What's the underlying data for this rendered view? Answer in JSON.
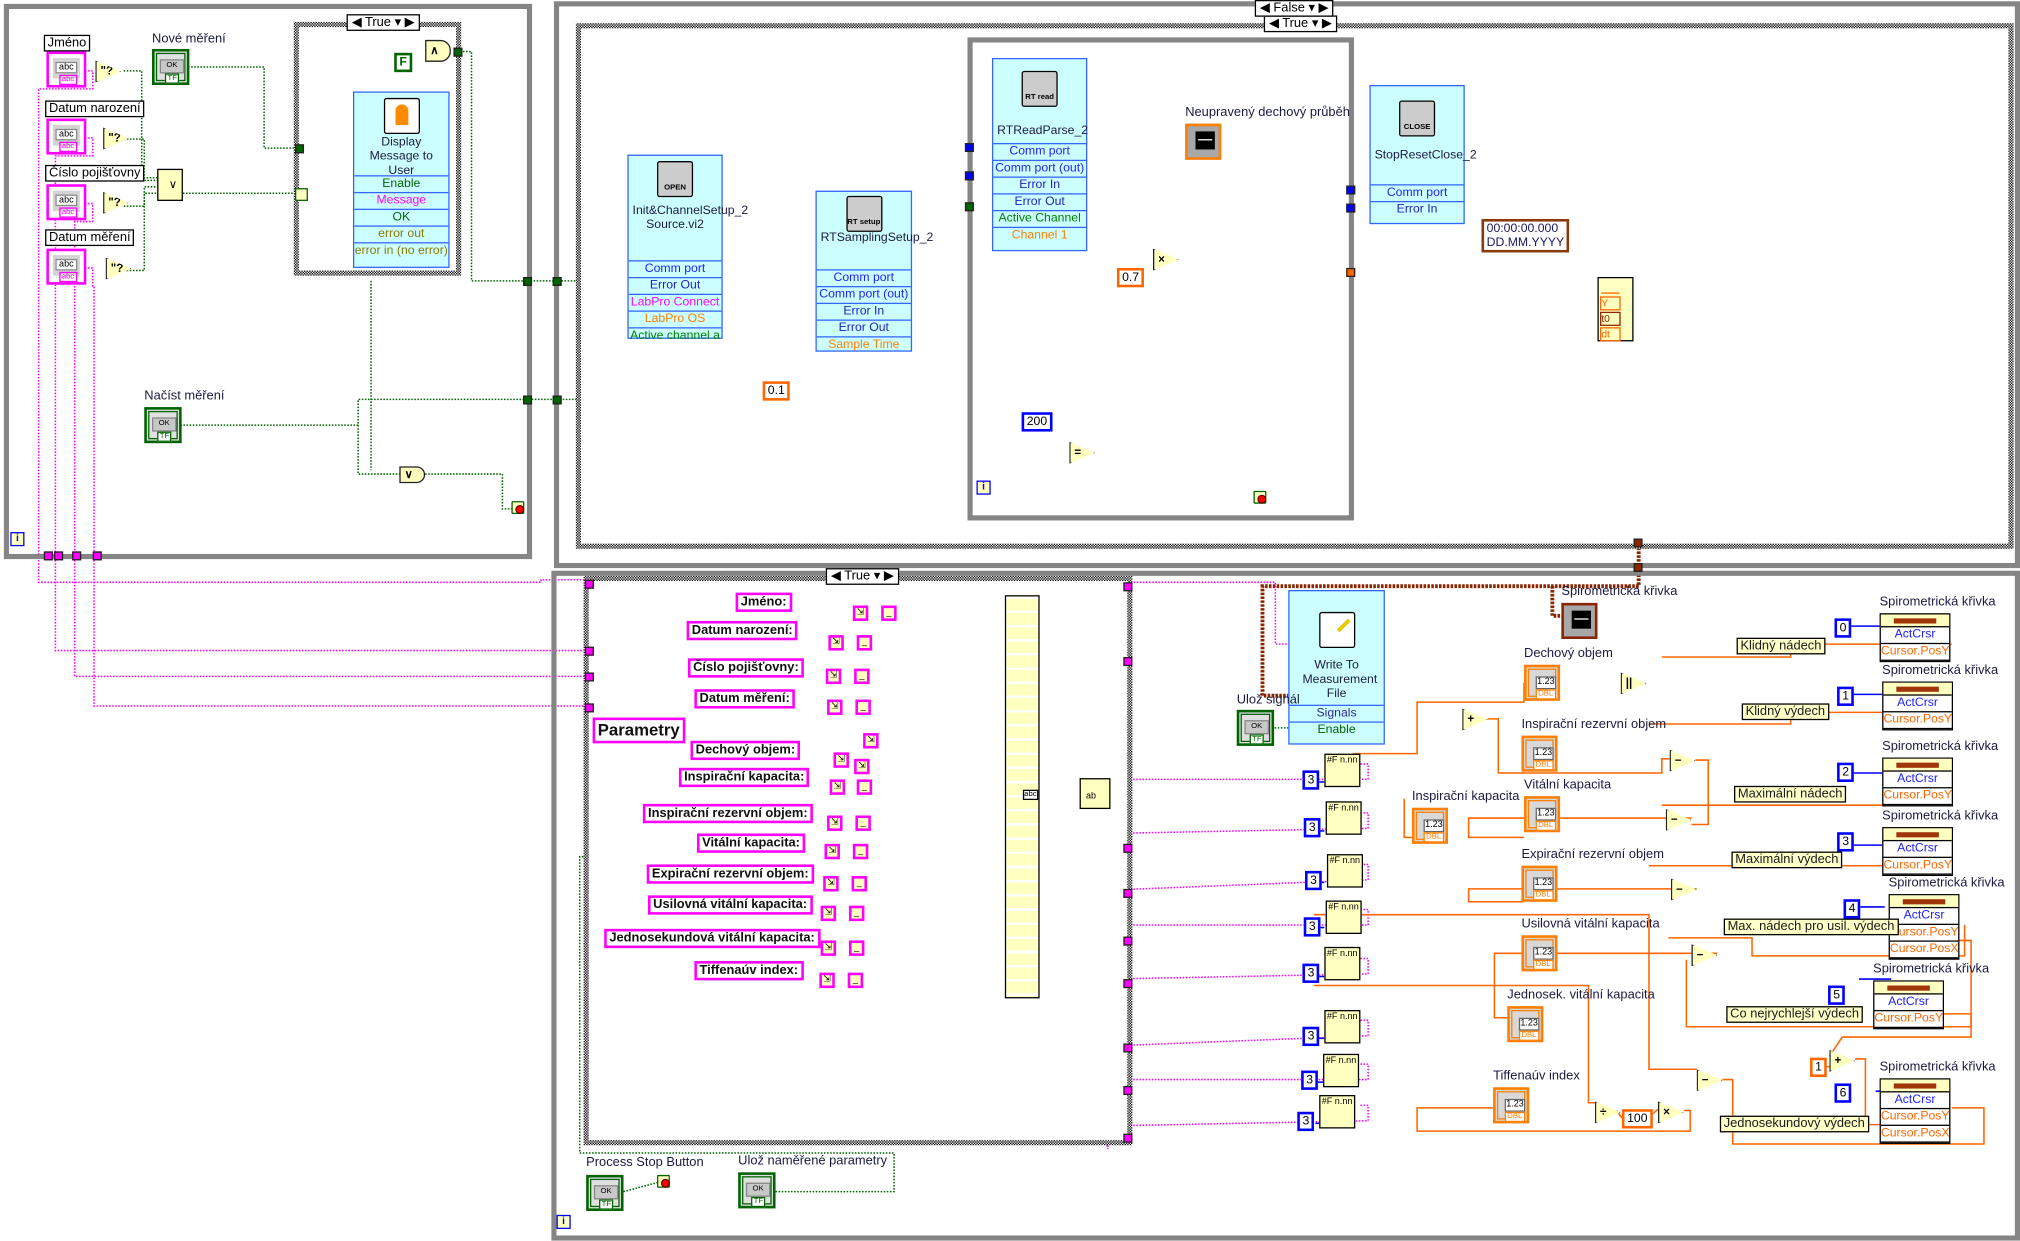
{
  "colors": {
    "string_wire": "#ff00ff",
    "boolean_wire": "#006400",
    "cluster_wire": "#0000ff",
    "numeric_wire": "#ff6600",
    "dynamic_wire": "#8b2500",
    "structure_border": "#858585",
    "subvi_background": "#ccffff",
    "primitive_background": "#ffffc0"
  },
  "glyphs": {
    "string_face": "abc",
    "string_foot": "abc",
    "bool_face": "OK",
    "bool_foot": "TF",
    "dbl_face": "1.23",
    "dbl_foot": "DBL",
    "iteration": "i",
    "format_node": "#F n.nn",
    "empty_string": "_",
    "concat_out": "abc",
    "write_text": "ab"
  },
  "left_loop": {
    "string_controls": [
      "Jméno",
      "Datum narození",
      "Číslo pojišťovny",
      "Datum měření"
    ],
    "empty_string_test": "\"?",
    "or_node": "∨",
    "and_node": "∧",
    "or_node2": "∨",
    "false_constant": "F",
    "new_measurement": "Nové měření",
    "load_measurement": "Načíst měření",
    "case_selector": "True",
    "display_message": {
      "title": "Display Message to User",
      "terminals": [
        "Enable",
        "Message",
        "OK",
        "error out",
        "error in (no error)"
      ]
    }
  },
  "top_loop": {
    "outer_case_selector": "False",
    "inner_case_selector": "True",
    "init": {
      "icon": "OPEN",
      "title": "Init&ChannelSetup_2 Source.vi2",
      "terminals": [
        "Comm port",
        "Error Out",
        "LabPro Connect",
        "LabPro OS",
        "Active channel a"
      ]
    },
    "sampling": {
      "icon": "RT setup",
      "title": "RTSamplingSetup_2",
      "terminals": [
        "Comm port",
        "Comm port (out)",
        "Error In",
        "Error Out",
        "Sample Time"
      ]
    },
    "read": {
      "icon": "RT read",
      "title": "RTReadParse_2",
      "terminals": [
        "Comm port",
        "Comm port (out)",
        "Error In",
        "Error Out",
        "Active Channel",
        "Channel 1"
      ]
    },
    "close": {
      "icon": "CLOSE",
      "title": "StopResetClose_2",
      "terminals": [
        "Comm port",
        "Error In"
      ]
    },
    "sample_time": "0.1",
    "iteration_limit": "200",
    "equal_node": "=",
    "gain": "0.7",
    "multiply_node": "×",
    "timestamp_line1": "00:00:00.000",
    "timestamp_line2": "DD.MM.YYYY",
    "raw_graph_label": "Neupravený dechový průběh",
    "waveform_terminals": [
      "Y",
      "t0",
      "dt"
    ]
  },
  "bottom_loop": {
    "case_selector": "True",
    "report_labels": [
      "Jméno:",
      "Datum narození:",
      "Číslo pojišťovny:",
      "Datum měření:",
      "Parametry",
      "Dechový objem:",
      "Inspirační kapacita:",
      "Inspirační rezervní objem:",
      "Vitální kapacita:",
      "Expirační rezervní objem:",
      "Usilovná vitální kapacita:",
      "Jednosekundová vitální kapacita:",
      "Tiffenaúv index:"
    ],
    "write_file": {
      "title": "Write To Measurement File",
      "terminals": [
        "Signals",
        "Enable"
      ]
    },
    "save_signal": "Ulož signál",
    "curve_graph_label": "Spirometrická křivka",
    "indicators": [
      "Dechový objem",
      "Inspirační rezervní objem",
      "Inspirační kapacita",
      "Vitální kapacita",
      "Expirační rezervní objem",
      "Usilovná vitální kapacita",
      "Jednosek. vitální kapacita",
      "Tiffenaúv index"
    ],
    "precision_constants": [
      "3",
      "3",
      "3",
      "3",
      "3",
      "3",
      "3",
      "3"
    ],
    "property_nodes": [
      {
        "label": "Spirometrická křivka",
        "cursor": "0",
        "props": [
          "ActCrsr",
          "Cursor.PosY"
        ]
      },
      {
        "label": "Spirometrická křivka",
        "cursor": "1",
        "props": [
          "ActCrsr",
          "Cursor.PosY"
        ]
      },
      {
        "label": "Spirometrická křivka",
        "cursor": "2",
        "props": [
          "ActCrsr",
          "Cursor.PosY"
        ]
      },
      {
        "label": "Spirometrická křivka",
        "cursor": "3",
        "props": [
          "ActCrsr",
          "Cursor.PosY"
        ]
      },
      {
        "label": "Spirometrická křivka",
        "cursor": "4",
        "props": [
          "ActCrsr",
          "Cursor.PosY",
          "Cursor.PosX"
        ]
      },
      {
        "label": "Spirometrická křivka",
        "cursor": "5",
        "props": [
          "ActCrsr",
          "Cursor.PosY"
        ]
      },
      {
        "label": "Spirometrická křivka",
        "cursor": "6",
        "props": [
          "ActCrsr",
          "Cursor.PosY",
          "Cursor.PosX"
        ]
      }
    ],
    "free_labels": [
      "Klidný nádech",
      "Klidný výdech",
      "Maximální nádech",
      "Maximální výdech",
      "Max. nádech pro usil. výdech",
      "Co nejrychlejší výdech",
      "Jednosekundový výdech"
    ],
    "arith_nodes": [
      "+",
      "||",
      "−",
      "−",
      "−",
      "−",
      "−",
      "÷",
      "×",
      "+"
    ],
    "percent_constant": "100",
    "increment_constant": "1",
    "process_stop": "Process Stop Button",
    "save_parameters": "Ulož naměřené parametry"
  }
}
